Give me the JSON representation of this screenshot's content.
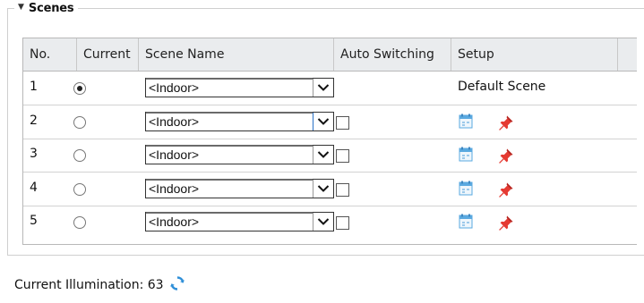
{
  "section": {
    "title": "Scenes"
  },
  "table": {
    "columns": [
      "No.",
      "Current",
      "Scene Name",
      "Auto Switching",
      "Setup"
    ],
    "rows": [
      {
        "no": "1",
        "current": true,
        "scene": "<Indoor>",
        "setup_text": "Default Scene"
      },
      {
        "no": "2",
        "current": false,
        "scene": "<Indoor>",
        "auto_switching": false
      },
      {
        "no": "3",
        "current": false,
        "scene": "<Indoor>",
        "auto_switching": false
      },
      {
        "no": "4",
        "current": false,
        "scene": "<Indoor>",
        "auto_switching": false
      },
      {
        "no": "5",
        "current": false,
        "scene": "<Indoor>",
        "auto_switching": false
      }
    ]
  },
  "illumination": {
    "label": "Current Illumination: 63"
  },
  "icons": {
    "collapse": "collapse-triangle-icon",
    "calendar": "calendar-schedule-icon",
    "pin": "pin-icon",
    "refresh": "refresh-icon",
    "dropdown": "chevron-down-icon"
  },
  "colors": {
    "pin": "#e53a32",
    "calendar": "#5aa9e0",
    "refresh": "#2f8fd8",
    "header_bg": "#eaecee"
  }
}
